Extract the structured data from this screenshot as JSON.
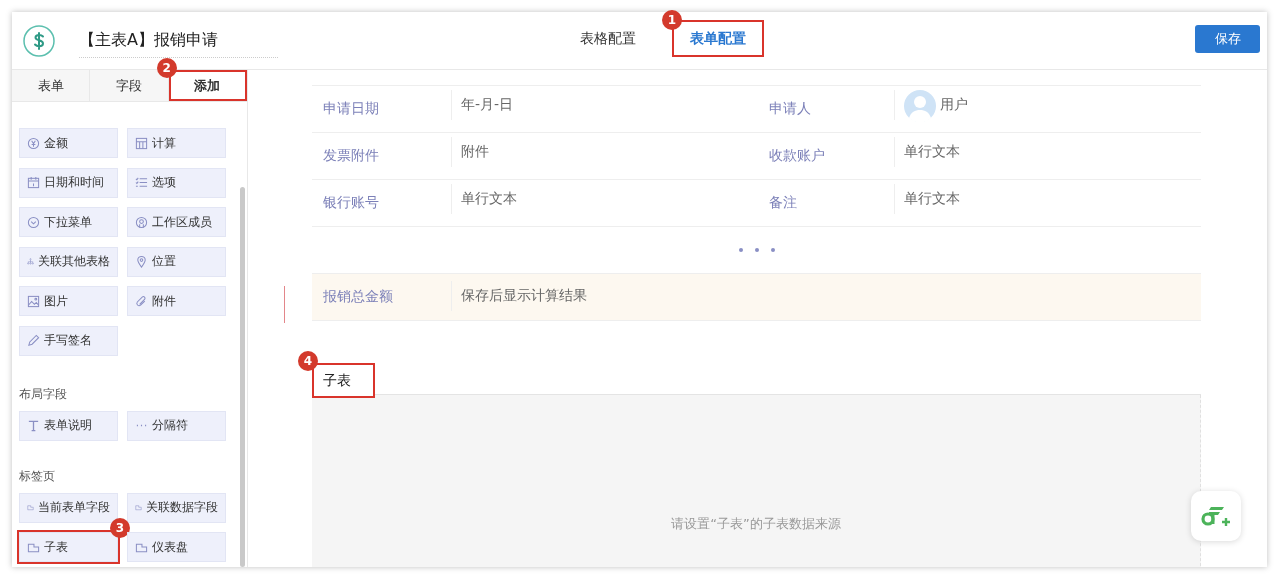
{
  "header": {
    "title": "【主表A】报销申请",
    "tabs": [
      {
        "label": "表格配置",
        "selected": false,
        "highlighted": false
      },
      {
        "label": "表单配置",
        "selected": true,
        "highlighted": true,
        "badge": "1"
      }
    ],
    "save_button": "保存"
  },
  "left_panel": {
    "tabs": [
      {
        "label": "表单",
        "selected": false,
        "highlighted": false
      },
      {
        "label": "字段",
        "selected": false,
        "highlighted": false
      },
      {
        "label": "添加",
        "selected": true,
        "highlighted": true,
        "badge": "2"
      }
    ],
    "sections": [
      {
        "items": [
          {
            "label": "金额",
            "highlighted": false
          },
          {
            "label": "计算",
            "highlighted": false
          },
          {
            "label": "日期和时间",
            "highlighted": false
          },
          {
            "label": "选项",
            "highlighted": false
          },
          {
            "label": "下拉菜单",
            "highlighted": false
          },
          {
            "label": "工作区成员",
            "highlighted": false
          },
          {
            "label": "关联其他表格",
            "highlighted": false
          },
          {
            "label": "位置",
            "highlighted": false
          },
          {
            "label": "图片",
            "highlighted": false
          },
          {
            "label": "附件",
            "highlighted": false
          },
          {
            "label": "手写签名",
            "highlighted": false
          }
        ]
      },
      {
        "heading": "布局字段",
        "items": [
          {
            "label": "表单说明",
            "highlighted": false
          },
          {
            "label": "分隔符",
            "highlighted": false
          }
        ]
      },
      {
        "heading": "标签页",
        "items": [
          {
            "label": "当前表单字段",
            "highlighted": false
          },
          {
            "label": "关联数据字段",
            "highlighted": false
          },
          {
            "label": "子表",
            "highlighted": true,
            "badge": "3"
          },
          {
            "label": "仪表盘",
            "highlighted": false
          }
        ]
      }
    ]
  },
  "form": {
    "rows": [
      {
        "kind": "fields",
        "cells": [
          {
            "label": "申请日期",
            "value": "年-月-日"
          },
          {
            "label": "申请人",
            "value": "用户",
            "kind": "user"
          }
        ]
      },
      {
        "kind": "fields",
        "cells": [
          {
            "label": "发票附件",
            "value": "附件"
          },
          {
            "label": "收款账户",
            "value": "单行文本"
          }
        ]
      },
      {
        "kind": "fields",
        "cells": [
          {
            "label": "银行账号",
            "value": "单行文本"
          },
          {
            "label": "备注",
            "value": "单行文本"
          }
        ]
      },
      {
        "kind": "more"
      },
      {
        "kind": "summary",
        "cells": [
          {
            "label": "报销总金额",
            "value": "保存后显示计算结果"
          }
        ]
      }
    ],
    "subtable": {
      "tab": "子表",
      "highlighted": true,
      "badge": "4",
      "placeholder": "请设置“子表”的子表数据来源"
    }
  }
}
